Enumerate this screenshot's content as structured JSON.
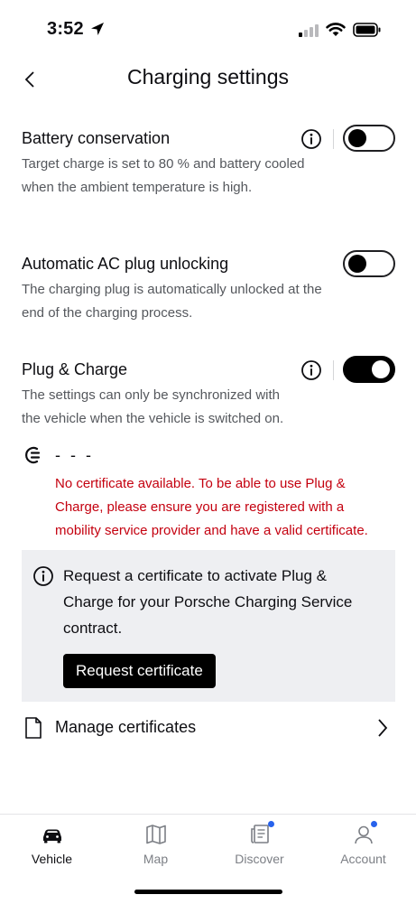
{
  "status_bar": {
    "time": "3:52"
  },
  "header": {
    "title": "Charging settings"
  },
  "settings": [
    {
      "title": "Battery conservation",
      "description": "Target charge is set to 80 % and battery cooled when the ambient temperature is high.",
      "toggle_on": false,
      "has_info": true
    },
    {
      "title": "Automatic AC plug unlocking",
      "description": "The charging plug is automatically unlocked at the end of the charging process.",
      "toggle_on": false,
      "has_info": false
    },
    {
      "title": "Plug & Charge",
      "description": "The settings can only be synchronized with the vehicle when the vehicle is switched on.",
      "toggle_on": true,
      "has_info": true
    }
  ],
  "certificate": {
    "value": "- - -",
    "error": "No certificate available. To be able to use Plug & Charge, please ensure you are registered with a mobility service provider and have a valid certificate."
  },
  "info_box": {
    "text": "Request a certificate to activate Plug & Charge for your Porsche Charging Service contract.",
    "button_label": "Request certificate"
  },
  "manage": {
    "label": "Manage certificates"
  },
  "tabs": [
    {
      "label": "Vehicle",
      "icon": "car-icon",
      "active": true,
      "badge": false
    },
    {
      "label": "Map",
      "icon": "map-icon",
      "active": false,
      "badge": false
    },
    {
      "label": "Discover",
      "icon": "discover-icon",
      "active": false,
      "badge": true
    },
    {
      "label": "Account",
      "icon": "account-icon",
      "active": false,
      "badge": true
    }
  ],
  "colors": {
    "error": "#c4000f",
    "badge": "#2762ec",
    "info_box_bg": "#eeeff2",
    "toggle_on": "#000000"
  }
}
